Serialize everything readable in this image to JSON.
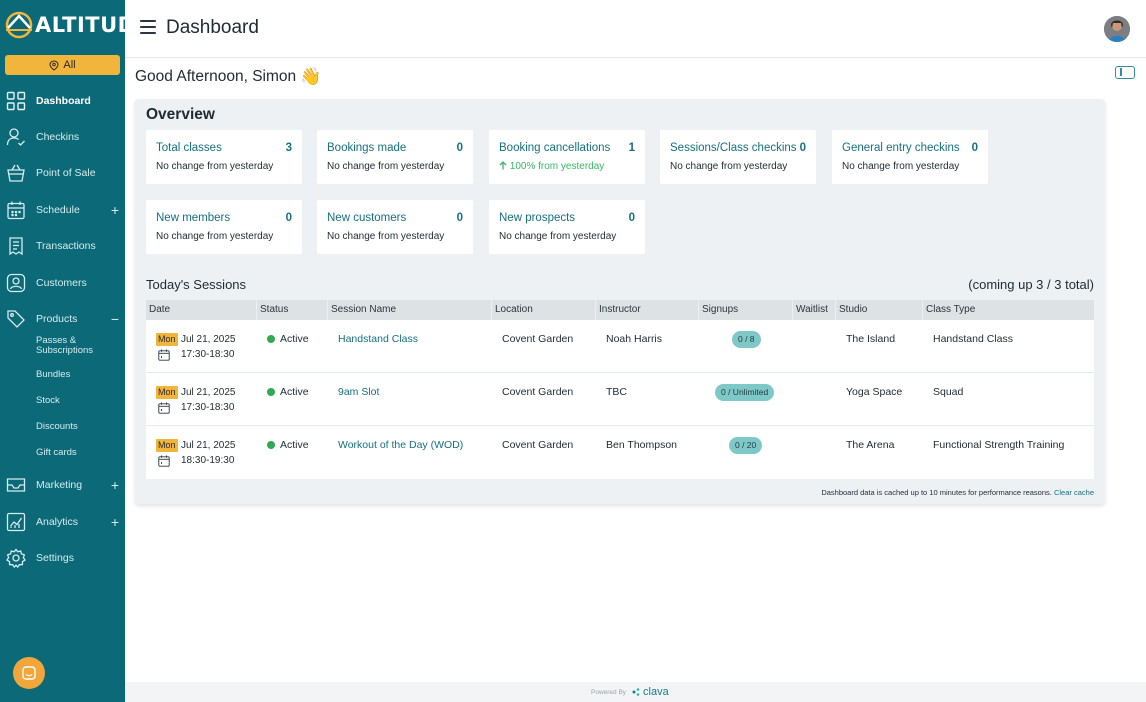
{
  "brand": {
    "name": "ALTITUDE"
  },
  "sidebar": {
    "location_button": "All",
    "items": [
      {
        "label": "Dashboard",
        "icon": "grid-icon"
      },
      {
        "label": "Checkins",
        "icon": "user-check-icon"
      },
      {
        "label": "Point of Sale",
        "icon": "basket-icon"
      },
      {
        "label": "Schedule",
        "icon": "calendar-icon",
        "expand": "+"
      },
      {
        "label": "Transactions",
        "icon": "receipt-icon"
      },
      {
        "label": "Customers",
        "icon": "customer-icon"
      },
      {
        "label": "Products",
        "icon": "tag-icon",
        "expand": "−"
      },
      {
        "label": "Marketing",
        "icon": "envelope-icon",
        "expand": "+"
      },
      {
        "label": "Analytics",
        "icon": "chart-icon",
        "expand": "+"
      },
      {
        "label": "Settings",
        "icon": "gear-icon"
      }
    ],
    "products_sub": [
      {
        "label": "Passes & Subscriptions"
      },
      {
        "label": "Bundles"
      },
      {
        "label": "Stock"
      },
      {
        "label": "Discounts"
      },
      {
        "label": "Gift cards"
      }
    ]
  },
  "header": {
    "title": "Dashboard"
  },
  "greeting": {
    "text": "Good Afternoon, Simon",
    "emoji": "👋"
  },
  "overview": {
    "title": "Overview",
    "stats": [
      {
        "label": "Total classes",
        "value": "3",
        "change": "No change from yesterday"
      },
      {
        "label": "Bookings made",
        "value": "0",
        "change": "No change from yesterday"
      },
      {
        "label": "Booking cancellations",
        "value": "1",
        "change": "100% from yesterday",
        "trend": "up"
      },
      {
        "label": "Sessions/Class checkins",
        "value": "0",
        "change": "No change from yesterday"
      },
      {
        "label": "General entry checkins",
        "value": "0",
        "change": "No change from yesterday"
      },
      {
        "label": "New members",
        "value": "0",
        "change": "No change from yesterday"
      },
      {
        "label": "New customers",
        "value": "0",
        "change": "No change from yesterday"
      },
      {
        "label": "New prospects",
        "value": "0",
        "change": "No change from yesterday"
      }
    ]
  },
  "sessions": {
    "title": "Today's Sessions",
    "count": "(coming up 3 / 3 total)",
    "columns": [
      "Date",
      "Status",
      "Session Name",
      "Location",
      "Instructor",
      "Signups",
      "Waitlist",
      "Studio",
      "Class Type"
    ],
    "rows": [
      {
        "day": "Mon",
        "date": "Jul 21, 2025",
        "time": "17:30-18:30",
        "status": "Active",
        "session": "Handstand Class",
        "location": "Covent Garden",
        "instructor": "Noah Harris",
        "signups": "0 / 8",
        "studio": "The Island",
        "class_type": "Handstand Class"
      },
      {
        "day": "Mon",
        "date": "Jul 21, 2025",
        "time": "17:30-18:30",
        "status": "Active",
        "session": "9am Slot",
        "location": "Covent Garden",
        "instructor": "TBC",
        "signups": "0 / Unlimited",
        "studio": "Yoga Space",
        "class_type": "Squad"
      },
      {
        "day": "Mon",
        "date": "Jul 21, 2025",
        "time": "18:30-19:30",
        "status": "Active",
        "session": "Workout of the Day (WOD)",
        "location": "Covent Garden",
        "instructor": "Ben Thompson",
        "signups": "0 / 20",
        "studio": "The Arena",
        "class_type": "Functional Strength Training"
      }
    ],
    "cache_note": "Dashboard data is cached up to 10 minutes for performance reasons.",
    "clear_cache": "Clear cache"
  },
  "footer": {
    "powered_by": "Powered By",
    "brand": "clava"
  },
  "colors": {
    "sidebar": "#0c6a78",
    "accent": "#f0b53a",
    "link": "#16707e",
    "active_dot": "#33a852",
    "signup_pill": "#7fc8c8"
  }
}
